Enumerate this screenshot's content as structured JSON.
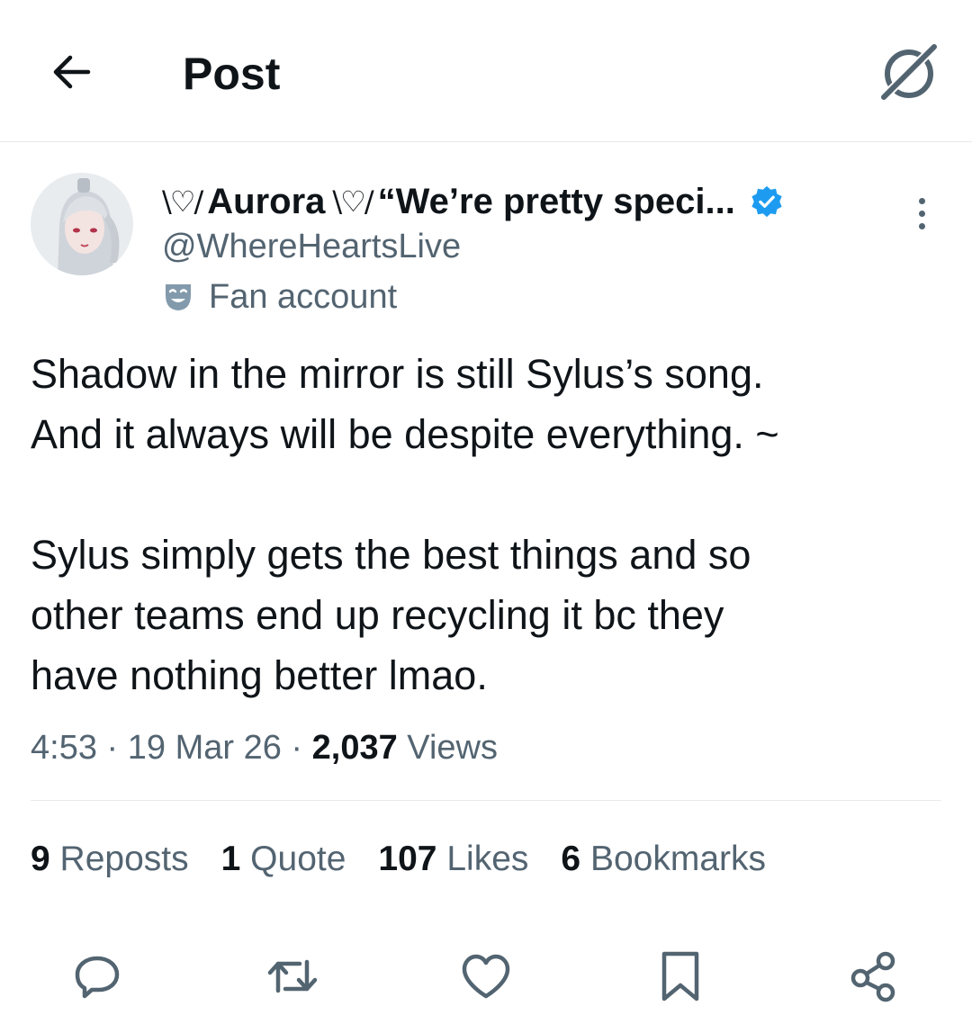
{
  "header": {
    "title": "Post",
    "back_icon": "arrow-left-icon",
    "grok_icon": "grok-icon"
  },
  "author": {
    "deco_left": "\\♡/",
    "display_name": "Aurora",
    "deco_right": "\\♡/",
    "bio_snippet": "“We’re pretty speci...",
    "handle": "@WhereHeartsLive",
    "label": "Fan account",
    "verified_color": "#1d9bf0"
  },
  "post": {
    "paragraph1_line1": "Shadow in the mirror is still Sylus’s song.",
    "paragraph1_line2": "And it always will be despite everything. ~",
    "paragraph2_line1": "Sylus simply gets the best things and so",
    "paragraph2_line2": "other teams end up recycling it bc they",
    "paragraph2_line3": "have nothing better lmao."
  },
  "meta": {
    "time": "4:53",
    "sep1": "·",
    "date": "19 Mar 26",
    "sep2": "·",
    "views_count": "2,037",
    "views_label": "Views"
  },
  "stats": {
    "reposts_count": "9",
    "reposts_label": "Reposts",
    "quotes_count": "1",
    "quotes_label": "Quote",
    "likes_count": "107",
    "likes_label": "Likes",
    "bookmarks_count": "6",
    "bookmarks_label": "Bookmarks"
  },
  "actions": [
    "reply-icon",
    "repost-icon",
    "like-icon",
    "bookmark-icon",
    "share-icon"
  ],
  "colors": {
    "text_primary": "#0f1419",
    "text_secondary": "#536471",
    "divider": "#e7e9ea"
  }
}
